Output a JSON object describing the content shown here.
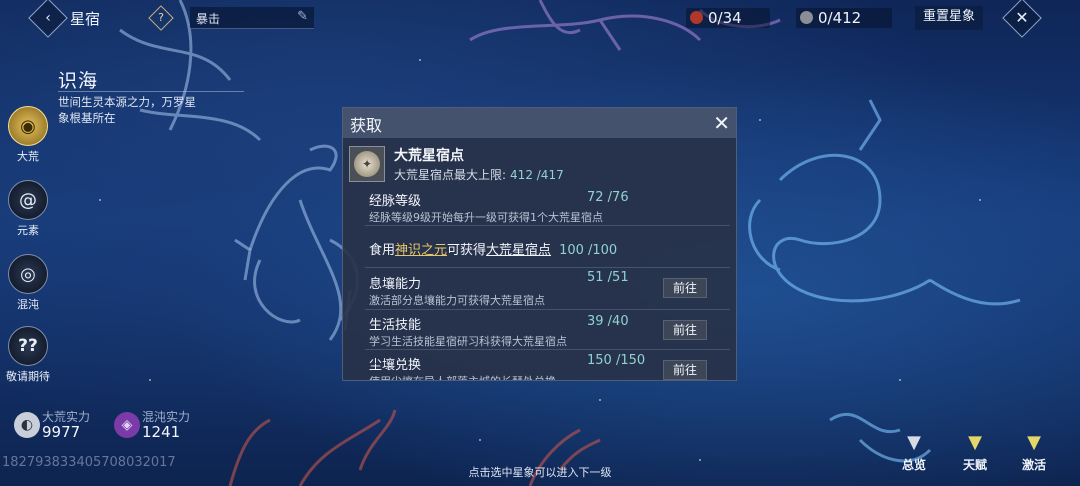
{
  "topbar": {
    "title": "星宿",
    "search_value": "暴击",
    "resource_red": "0/34",
    "resource_gray": "0/412",
    "reset_label": "重置星象"
  },
  "realm": {
    "title": "识海",
    "description": "世间生灵本源之力，万罗星象根基所在"
  },
  "sidebar": {
    "items": [
      {
        "label": "大荒",
        "icon": "dahuang-emblem-icon"
      },
      {
        "label": "元素",
        "icon": "swirl-icon"
      },
      {
        "label": "混沌",
        "icon": "chaos-icon"
      },
      {
        "label": "敬请期待",
        "icon": "question-icon",
        "glyph": "??"
      }
    ]
  },
  "powers": {
    "dahuang_label": "大荒实力",
    "dahuang_value": "9977",
    "hundun_label": "混沌实力",
    "hundun_value": "1241"
  },
  "footer": {
    "uid": "182793833405708032017",
    "hint": "点击选中星象可以进入下一级",
    "buttons": [
      {
        "label": "总览",
        "icon": "overview-icon"
      },
      {
        "label": "天赋",
        "icon": "talent-icon"
      },
      {
        "label": "激活",
        "icon": "activate-icon"
      }
    ]
  },
  "dialog": {
    "title": "获取",
    "item_name": "大荒星宿点",
    "item_max_label": "大荒星宿点最大上限:",
    "item_max_value": "412 /417",
    "sources": [
      {
        "title": "经脉等级",
        "count": "72 /76",
        "desc": "经脉等级9级开始每升一级可获得1个大荒星宿点"
      },
      {
        "food_prefix": "食用",
        "food_item": "神识之元",
        "food_middle": "可获得",
        "food_reward": "大荒星宿点",
        "count": "100 /100"
      },
      {
        "title": "息壤能力",
        "count": "51 /51",
        "desc": "激活部分息壤能力可获得大荒星宿点",
        "button": "前往"
      },
      {
        "title": "生活技能",
        "count": "39 /40",
        "desc": "学习生活技能星宿研习科获得大荒星宿点",
        "button": "前往"
      },
      {
        "title": "尘壤兑换",
        "count": "150 /150",
        "desc": "使用尘壤在导人部落主城的长琴处兑换",
        "button": "前往"
      }
    ]
  },
  "colors": {
    "accent_teal": "#8fd3d0",
    "accent_gold": "#e9c56a",
    "background": "#163a7a"
  }
}
